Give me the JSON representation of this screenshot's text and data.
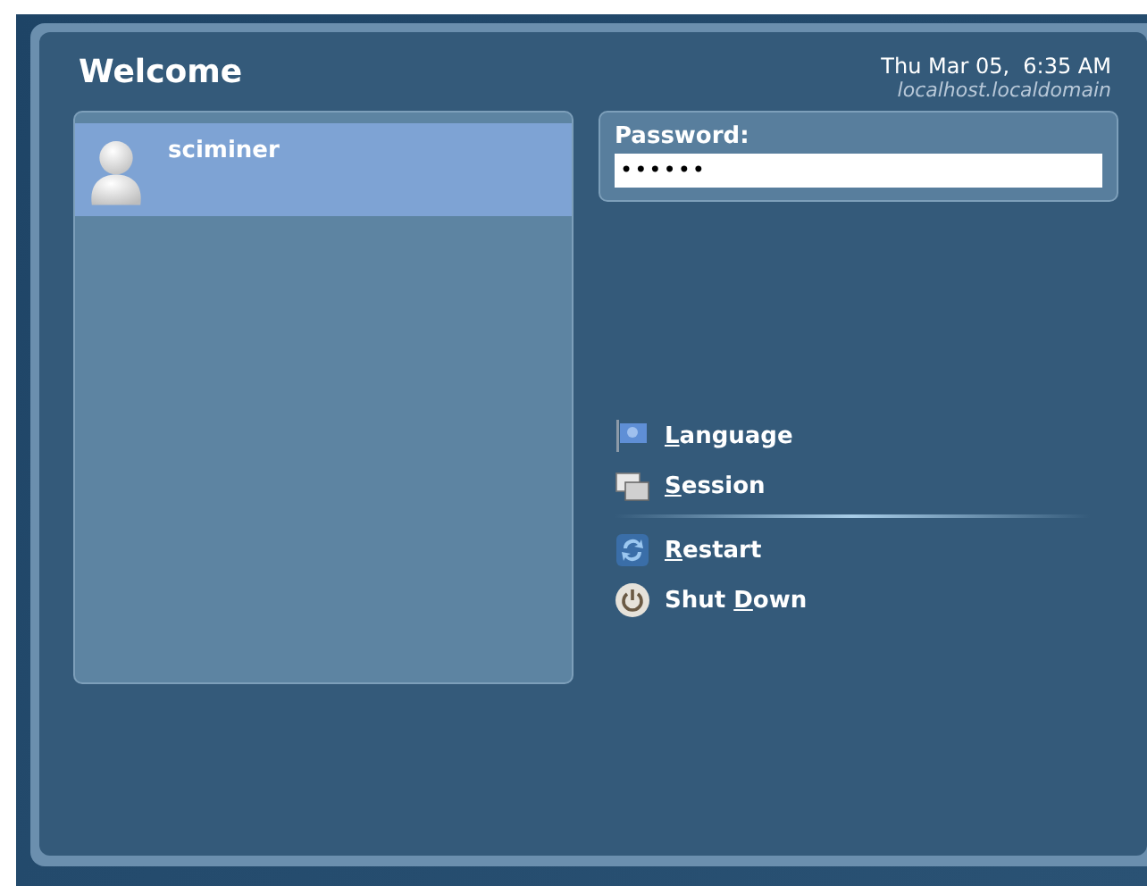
{
  "header": {
    "title": "Welcome",
    "datetime": "Thu Mar 05,  6:35 AM",
    "hostname": "localhost.localdomain"
  },
  "users": [
    {
      "name": "sciminer",
      "selected": true
    }
  ],
  "password": {
    "label": "Password:",
    "value": "••••••"
  },
  "actions": [
    {
      "kind": "language",
      "key": "L",
      "post": "anguage"
    },
    {
      "kind": "session",
      "key": "S",
      "post": "ession"
    },
    {
      "kind": "separator"
    },
    {
      "kind": "restart",
      "key": "R",
      "post": "estart"
    },
    {
      "kind": "shutdown",
      "pre": "Shut ",
      "key": "D",
      "post": "own"
    }
  ]
}
